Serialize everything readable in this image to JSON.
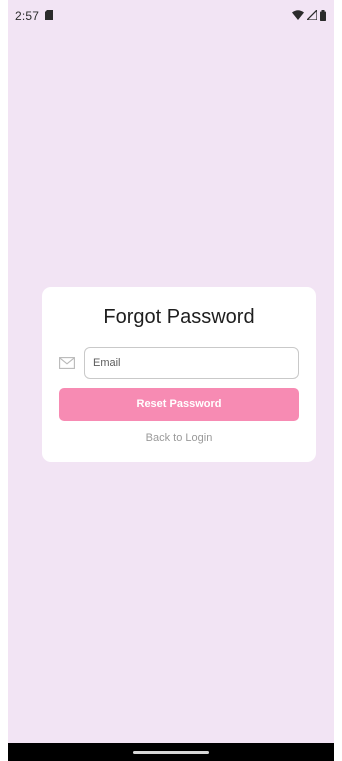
{
  "status_bar": {
    "time": "2:57",
    "icons": [
      "sd-card-icon",
      "wifi-icon",
      "signal-icon",
      "battery-icon"
    ]
  },
  "forgot_password": {
    "title": "Forgot Password",
    "email_placeholder": "Email",
    "email_value": "",
    "reset_button_label": "Reset Password",
    "back_link_label": "Back to Login",
    "icon": "mail-icon"
  },
  "colors": {
    "background": "#f2e4f4",
    "card": "#ffffff",
    "button": "#f78bb3",
    "button_text": "#ffffff",
    "link_text": "#9a9a9a",
    "nav_bar": "#000000"
  }
}
